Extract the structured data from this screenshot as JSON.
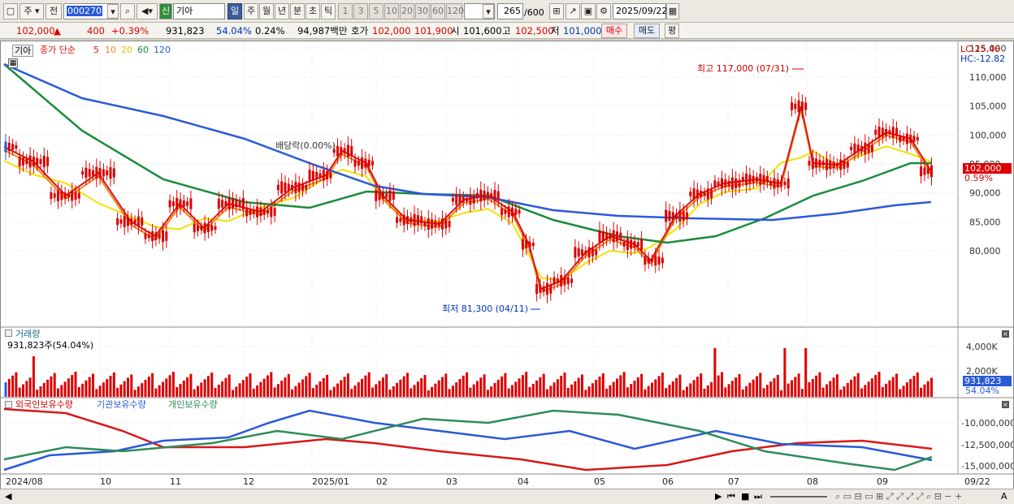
{
  "toolbar": {
    "kind_label": "주",
    "kind2_label": "전",
    "code_value": "000270",
    "search_icon": "search-icon",
    "shin_label": "신",
    "name_value": "기아",
    "periods": [
      "일",
      "주",
      "월",
      "년",
      "분",
      "초",
      "틱"
    ],
    "nums": [
      "1",
      "3",
      "5",
      "10",
      "20",
      "30",
      "60",
      "120"
    ],
    "count_value": "265",
    "count_total": "/600",
    "date_value": "2025/09/22"
  },
  "quote": {
    "price": "102,000",
    "arrow": "▲",
    "change": "400",
    "rate": "+0.39%",
    "volume": "931,823",
    "vol_pct": "54.04%",
    "turnover_pct": "0.24%",
    "amount": "94,987백만",
    "bid_label": "호가",
    "bid1": "102,000",
    "bid2": "101,900",
    "open_label": "시",
    "open": "101,600",
    "high_label": "고",
    "high": "102,500",
    "low_label": "저",
    "low": "101,000",
    "buy_label": "매수",
    "sell_label": "매도",
    "eval_label": "평"
  },
  "price_pane": {
    "name": "기아",
    "ma_title": "종가 단순",
    "ma_periods": [
      "5",
      "10",
      "20",
      "60",
      "120"
    ],
    "ma_colors": [
      "#d81818",
      "#f08c1c",
      "#f4e000",
      "#1a8c3c",
      "#2a5ad8"
    ],
    "lc": "LC:25.46",
    "hc": "HC:-12.82",
    "high_note": "최고 117,000 (07/31)",
    "low_note": "최저 81,300 (04/11)",
    "div_note": "배당락(0.00%)",
    "last_price": "102,000",
    "last_pct": "0.59%",
    "ylabels": [
      "115,000",
      "110,000",
      "105,000",
      "100,000",
      "95,000",
      "90,000",
      "85,000",
      "80,000"
    ]
  },
  "volume_pane": {
    "title": "거래량",
    "value": "931,823주(54.04%)",
    "ylabels": [
      "4,000K",
      "2,000K"
    ],
    "last_value": "931,823",
    "last_pct": "54.04%"
  },
  "holding_pane": {
    "titles": [
      "외국인보유수량",
      "기관보유수량",
      "개인보유수량"
    ],
    "colors": [
      "#d81818",
      "#2a5ad8",
      "#2e8c5a"
    ],
    "ylabels": [
      "-10,000,000",
      "-12,500,000",
      "-15,000,000"
    ]
  },
  "xaxis": [
    "2024/08",
    "10",
    "11",
    "12",
    "2025/01",
    "02",
    "03",
    "04",
    "05",
    "06",
    "07",
    "08",
    "09",
    "09/22"
  ]
}
